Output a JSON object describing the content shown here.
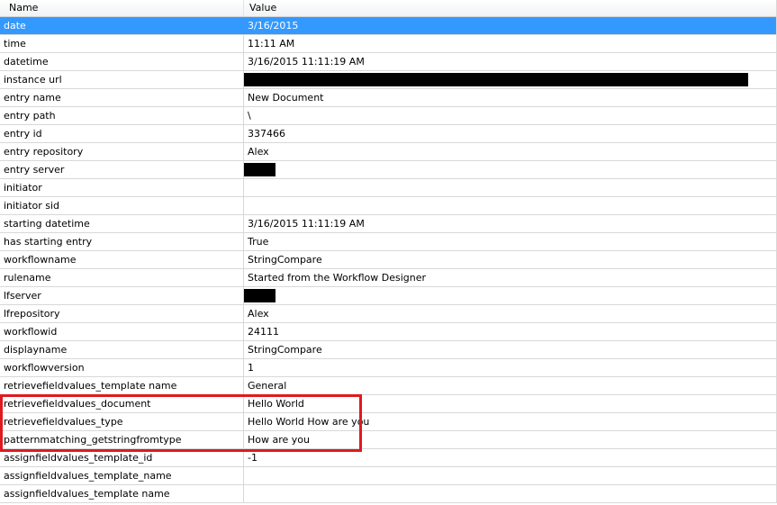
{
  "columns": {
    "name": "Name",
    "value": "Value"
  },
  "rows": [
    {
      "name": "date",
      "value": "3/16/2015"
    },
    {
      "name": "time",
      "value": "11:11 AM"
    },
    {
      "name": "datetime",
      "value": "3/16/2015 11:11:19 AM"
    },
    {
      "name": "instance url",
      "value": ""
    },
    {
      "name": "entry name",
      "value": "New Document"
    },
    {
      "name": "entry path",
      "value": "\\"
    },
    {
      "name": "entry id",
      "value": "337466"
    },
    {
      "name": "entry repository",
      "value": "Alex"
    },
    {
      "name": "entry server",
      "value": ""
    },
    {
      "name": "initiator",
      "value": ""
    },
    {
      "name": "initiator sid",
      "value": ""
    },
    {
      "name": "starting datetime",
      "value": "3/16/2015 11:11:19 AM"
    },
    {
      "name": "has starting entry",
      "value": "True"
    },
    {
      "name": "workflowname",
      "value": "StringCompare"
    },
    {
      "name": "rulename",
      "value": "Started from the Workflow Designer"
    },
    {
      "name": "lfserver",
      "value": ""
    },
    {
      "name": "lfrepository",
      "value": "Alex"
    },
    {
      "name": "workflowid",
      "value": "24111"
    },
    {
      "name": "displayname",
      "value": "StringCompare"
    },
    {
      "name": "workflowversion",
      "value": "1"
    },
    {
      "name": "retrievefieldvalues_template name",
      "value": "General"
    },
    {
      "name": "retrievefieldvalues_document",
      "value": "Hello World"
    },
    {
      "name": "retrievefieldvalues_type",
      "value": "Hello World How are you"
    },
    {
      "name": "patternmatching_getstringfromtype",
      "value": "How are you"
    },
    {
      "name": "assignfieldvalues_template_id",
      "value": "-1"
    },
    {
      "name": "assignfieldvalues_template_name",
      "value": ""
    },
    {
      "name": "assignfieldvalues_template name",
      "value": ""
    }
  ],
  "selected_row": "date",
  "colors": {
    "selection": "#3399ff",
    "highlight_box": "#e0191f",
    "redaction": "#000000"
  }
}
